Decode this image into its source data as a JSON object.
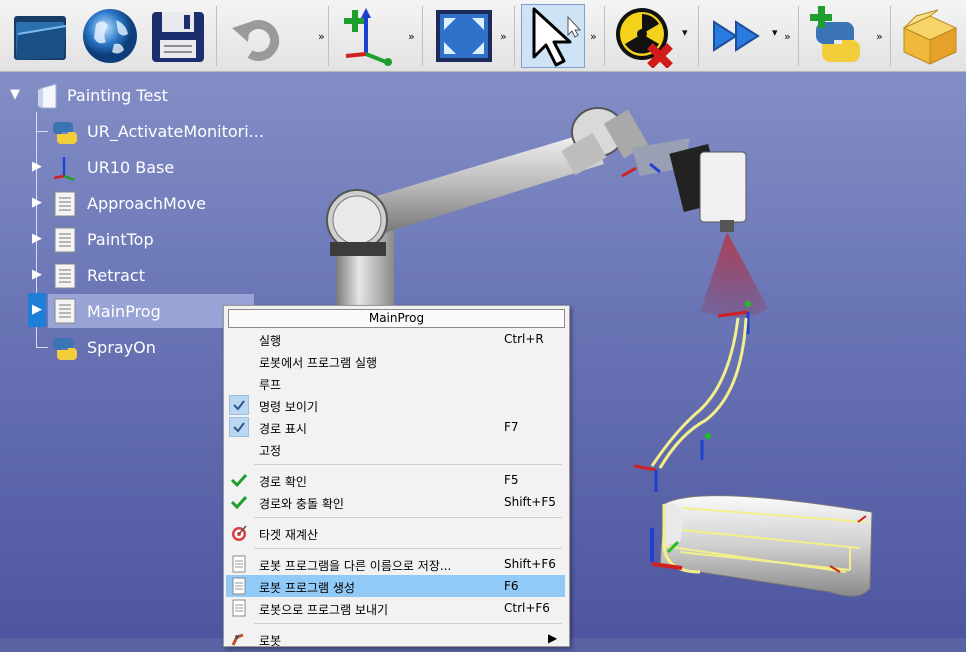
{
  "toolbar": {
    "buttons": [
      {
        "icon": "open-folder-icon"
      },
      {
        "icon": "globe-icon"
      },
      {
        "icon": "save-icon"
      },
      {
        "icon": "undo-icon"
      },
      {
        "icon": "add-reference-frame-icon"
      },
      {
        "icon": "fit-view-icon"
      },
      {
        "icon": "select-cursor-icon"
      },
      {
        "icon": "collision-off-icon"
      },
      {
        "icon": "fast-forward-icon"
      },
      {
        "icon": "add-python-icon"
      },
      {
        "icon": "package-icon"
      }
    ],
    "more": "»",
    "dropdown": "▾"
  },
  "tree": {
    "root": {
      "label": "Painting Test",
      "expander": "▼"
    },
    "items": [
      {
        "label": "UR_ActivateMonitori...",
        "icon": "python-icon",
        "expander": ""
      },
      {
        "label": "UR10 Base",
        "icon": "reference-frame-icon",
        "expander": "▶"
      },
      {
        "label": "ApproachMove",
        "icon": "program-icon",
        "expander": "▶"
      },
      {
        "label": "PaintTop",
        "icon": "program-icon",
        "expander": "▶"
      },
      {
        "label": "Retract",
        "icon": "program-icon",
        "expander": "▶"
      },
      {
        "label": "MainProg",
        "icon": "program-icon",
        "expander": "▶"
      },
      {
        "label": "SprayOn",
        "icon": "python-icon",
        "expander": ""
      }
    ]
  },
  "menu": {
    "title": "MainProg",
    "items": [
      {
        "label": "실행",
        "shortcut": "Ctrl+R",
        "check": ""
      },
      {
        "label": "로봇에서 프로그램 실행",
        "shortcut": "",
        "check": ""
      },
      {
        "label": "루프",
        "shortcut": "",
        "check": ""
      },
      {
        "label": "명령 보이기",
        "shortcut": "",
        "check": "checked-box"
      },
      {
        "label": "경로 표시",
        "shortcut": "F7",
        "check": "checked-box"
      },
      {
        "label": "고정",
        "shortcut": "",
        "check": ""
      },
      {
        "label": "경로 확인",
        "shortcut": "F5",
        "check": "green-check"
      },
      {
        "label": "경로와 충돌 확인",
        "shortcut": "Shift+F5",
        "check": "green-check"
      },
      {
        "label": "타겟 재계산",
        "shortcut": "",
        "check": "target"
      },
      {
        "label": "로봇 프로그램을 다른 이름으로 저장...",
        "shortcut": "Shift+F6",
        "check": "doc"
      },
      {
        "label": "로봇 프로그램 생성",
        "shortcut": "F6",
        "check": "doc",
        "highlighted": true
      },
      {
        "label": "로봇으로 프로그램 보내기",
        "shortcut": "Ctrl+F6",
        "check": "doc"
      },
      {
        "label": "로봇",
        "shortcut": "",
        "check": "robot",
        "submenu": "▶"
      }
    ]
  },
  "colors": {
    "accent_blue": "#1f7fd8",
    "menu_highlight": "#91c9f7",
    "check_green": "#1e9e2e"
  }
}
